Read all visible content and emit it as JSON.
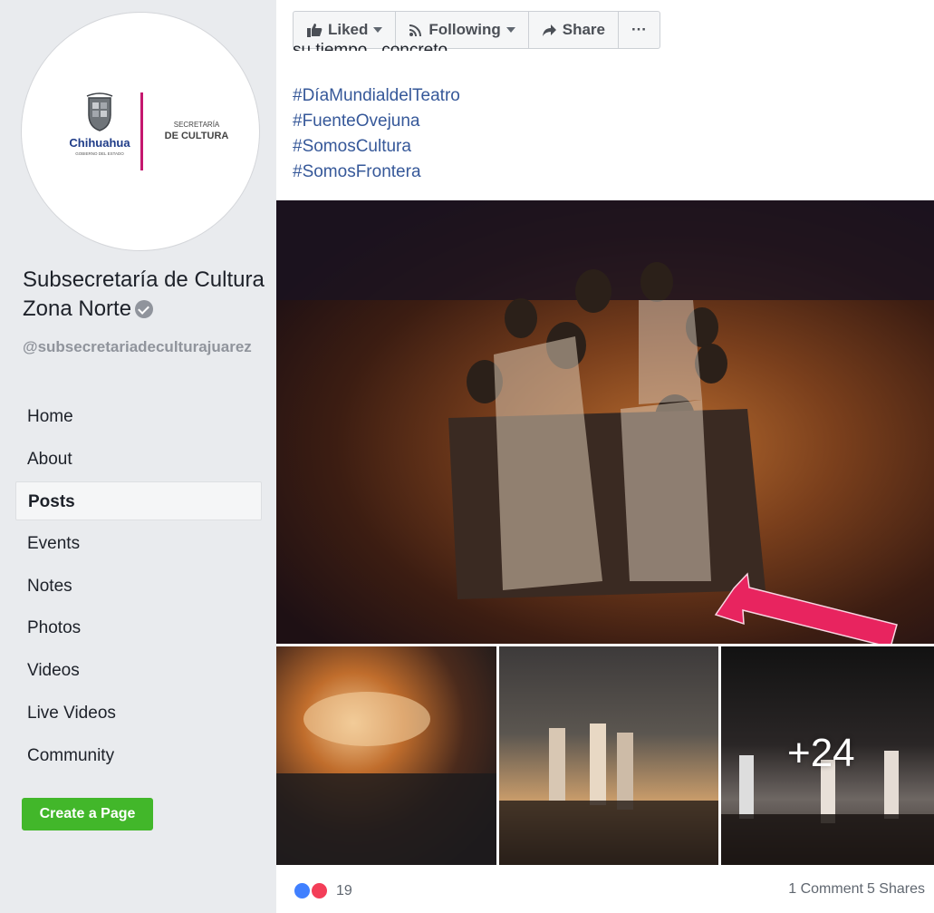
{
  "sidebar": {
    "logo": {
      "brand": "Chihuahua",
      "brand_sub": "GOBIERNO DEL ESTADO",
      "dept_line1": "SECRETARÍA",
      "dept_line2": "DE CULTURA"
    },
    "page_name": "Subsecretaría de Cultura Zona Norte",
    "handle": "@subsecretariadeculturajuarez",
    "nav": [
      {
        "label": "Home"
      },
      {
        "label": "About"
      },
      {
        "label": "Posts",
        "active": true
      },
      {
        "label": "Events"
      },
      {
        "label": "Notes"
      },
      {
        "label": "Photos"
      },
      {
        "label": "Videos"
      },
      {
        "label": "Live Videos"
      },
      {
        "label": "Community"
      }
    ],
    "create_page_label": "Create a Page"
  },
  "post": {
    "actions": {
      "liked": "Liked",
      "following": "Following",
      "share": "Share",
      "more": "···"
    },
    "cut_text": "su tiempo , concreto.",
    "hashtags": [
      "#DíaMundialdelTeatro",
      "#FuenteOvejuna",
      "#SomosCultura",
      "#SomosFrontera"
    ],
    "more_photos": "+24",
    "reaction_count": "19",
    "comments": "1 Comment",
    "shares": "5 Shares"
  },
  "colors": {
    "link": "#365899",
    "create_page": "#42b72a",
    "arrow": "#e8245f",
    "logo_magenta": "#c5186f",
    "logo_blue": "#1f3c88"
  }
}
